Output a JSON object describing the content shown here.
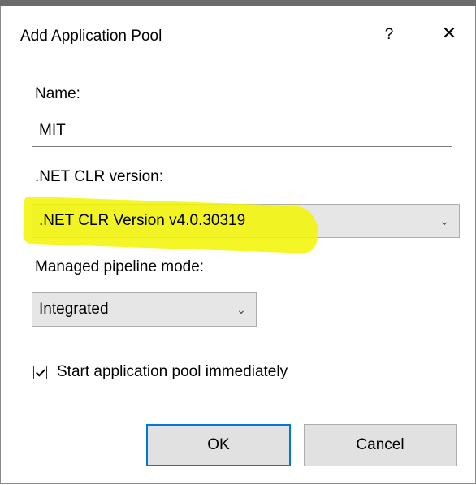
{
  "dialog": {
    "title": "Add Application Pool",
    "help_label": "?",
    "close_label": "✕"
  },
  "name": {
    "label": "Name:",
    "value": "MIT"
  },
  "clr": {
    "label": ".NET CLR version:",
    "selected": ".NET CLR Version v4.0.30319"
  },
  "pipeline": {
    "label": "Managed pipeline mode:",
    "selected": "Integrated"
  },
  "start_immediately": {
    "label": "Start application pool immediately",
    "checked": true
  },
  "buttons": {
    "ok": "OK",
    "cancel": "Cancel"
  },
  "colors": {
    "highlight": "#f2f500",
    "focus_border": "#0078d7"
  }
}
